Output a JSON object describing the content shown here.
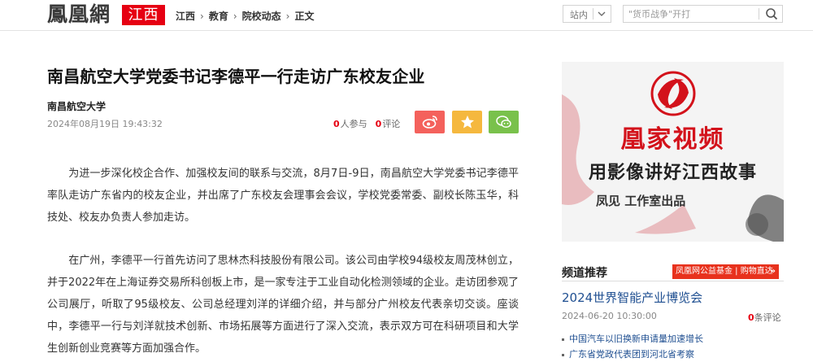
{
  "header": {
    "logo_text": "鳳凰網",
    "logo_region": "江西",
    "breadcrumb": [
      "江西",
      "教育",
      "院校动态",
      "正文"
    ],
    "breadcrumb_sep": "›",
    "site_select": "站内",
    "search_placeholder": "\"货币战争\"开打"
  },
  "article": {
    "title": "南昌航空大学党委书记李德平一行走访广东校友企业",
    "source": "南昌航空大学",
    "date": "2024年08月19日 19:43:32",
    "participants_count": "0",
    "participants_label": "人参与",
    "comments_count": "0",
    "comments_label": "评论",
    "paragraphs": [
      "为进一步深化校企合作、加强校友间的联系与交流，8月7日-9日，南昌航空大学党委书记李德平率队走访广东省内的校友企业，并出席了广东校友会理事会会议，学校党委常委、副校长陈玉华，科技处、校友办负责人参加走访。",
      "在广州，李德平一行首先访问了思林杰科技股份有限公司。该公司由学校94级校友周茂林创立，并于2022年在上海证券交易所科创板上市，是一家专注于工业自动化检测领域的企业。走访团参观了公司展厅，听取了95级校友、公司总经理刘洋的详细介绍，并与部分广州校友代表亲切交谈。座谈中，李德平一行与刘洋就技术创新、市场拓展等方面进行了深入交流，表示双方可在科研项目和大学生创新创业竞赛等方面加强合作。"
    ]
  },
  "sidebar": {
    "promo": {
      "line1": "凰家视频",
      "line2": "用影像讲好江西故事",
      "line3": "凤见 工作室出品"
    },
    "recommend": {
      "title": "频道推荐",
      "badge": "凤凰网公益基金",
      "badge_action": "购物直达",
      "featured_title": "2024世界智能产业博览会",
      "featured_date": "2024-06-20 10:30:00",
      "featured_comments": "0",
      "featured_comments_label": "条评论",
      "items": [
        "中国汽车以旧换新申请量加速增长",
        "广东省党政代表团到河北省考察"
      ]
    }
  },
  "colors": {
    "brand_red": "#e60012",
    "weibo": "#f4615c",
    "favorite": "#f5b83e",
    "wechat": "#79c14b",
    "link_blue": "#1f4f91"
  }
}
